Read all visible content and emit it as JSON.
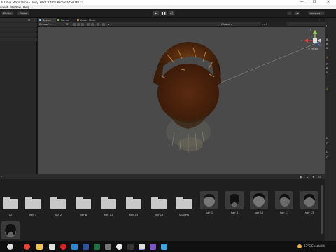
{
  "window": {
    "title": "k Linux Standalone - Unity 2020.3.41f1 Personal* <DX11>",
    "minimize": "—",
    "maximize": "☐",
    "close": "✕"
  },
  "menu": [
    "onent",
    "Window",
    "Help"
  ],
  "toolbar": {
    "left": [
      "Center",
      "Global"
    ],
    "right": "Account"
  },
  "scene_tabs": [
    {
      "label": "Scene",
      "icon_color": "#9ec3e6"
    },
    {
      "label": "Game",
      "icon_color": "#8fbf6b"
    },
    {
      "label": "Asset Store",
      "icon_color": "#c9a66b"
    }
  ],
  "scene_toolbar": {
    "shading": "Shaded",
    "mode": "2D",
    "gizmos": "Gizmos",
    "search": "All"
  },
  "gizmo": {
    "view_label": "< Persp",
    "axis_y": "y",
    "axis_x": "x"
  },
  "project_assets": [
    {
      "label": "02",
      "kind": "folder"
    },
    {
      "label": "hair 1",
      "kind": "folder"
    },
    {
      "label": "hair 2",
      "kind": "folder"
    },
    {
      "label": "hair 8",
      "kind": "folder"
    },
    {
      "label": "hair 11",
      "kind": "folder"
    },
    {
      "label": "hair 13",
      "kind": "folder"
    },
    {
      "label": "hair 16",
      "kind": "folder"
    },
    {
      "label": "Shaders",
      "kind": "folder"
    },
    {
      "label": "hair 1",
      "kind": "model"
    },
    {
      "label": "hair 8",
      "kind": "model"
    },
    {
      "label": "hair 10",
      "kind": "model"
    },
    {
      "label": "hair 11",
      "kind": "model"
    },
    {
      "label": "hair 13",
      "kind": "model"
    },
    {
      "label": "",
      "kind": "model"
    }
  ],
  "taskbar": {
    "weather": "23°C Ensoleillé",
    "icons": [
      {
        "name": "search-icon",
        "color": "#e0e0e0"
      },
      {
        "name": "chrome-icon",
        "color": "#e94335"
      },
      {
        "name": "explorer-icon",
        "color": "#f2c14e"
      },
      {
        "name": "opera-icon",
        "color": "#d22"
      },
      {
        "name": "edge-icon",
        "color": "#2a8bd8"
      },
      {
        "name": "word-icon",
        "color": "#2b579a"
      },
      {
        "name": "sheets-icon",
        "color": "#1e7145"
      },
      {
        "name": "media-icon",
        "color": "#777"
      },
      {
        "name": "terminal-icon",
        "color": "#333"
      },
      {
        "name": "unity-icon",
        "color": "#ddd"
      },
      {
        "name": "vs-icon",
        "color": "#7e57c2"
      },
      {
        "name": "photo-icon",
        "color": "#3ea6d8"
      }
    ]
  }
}
